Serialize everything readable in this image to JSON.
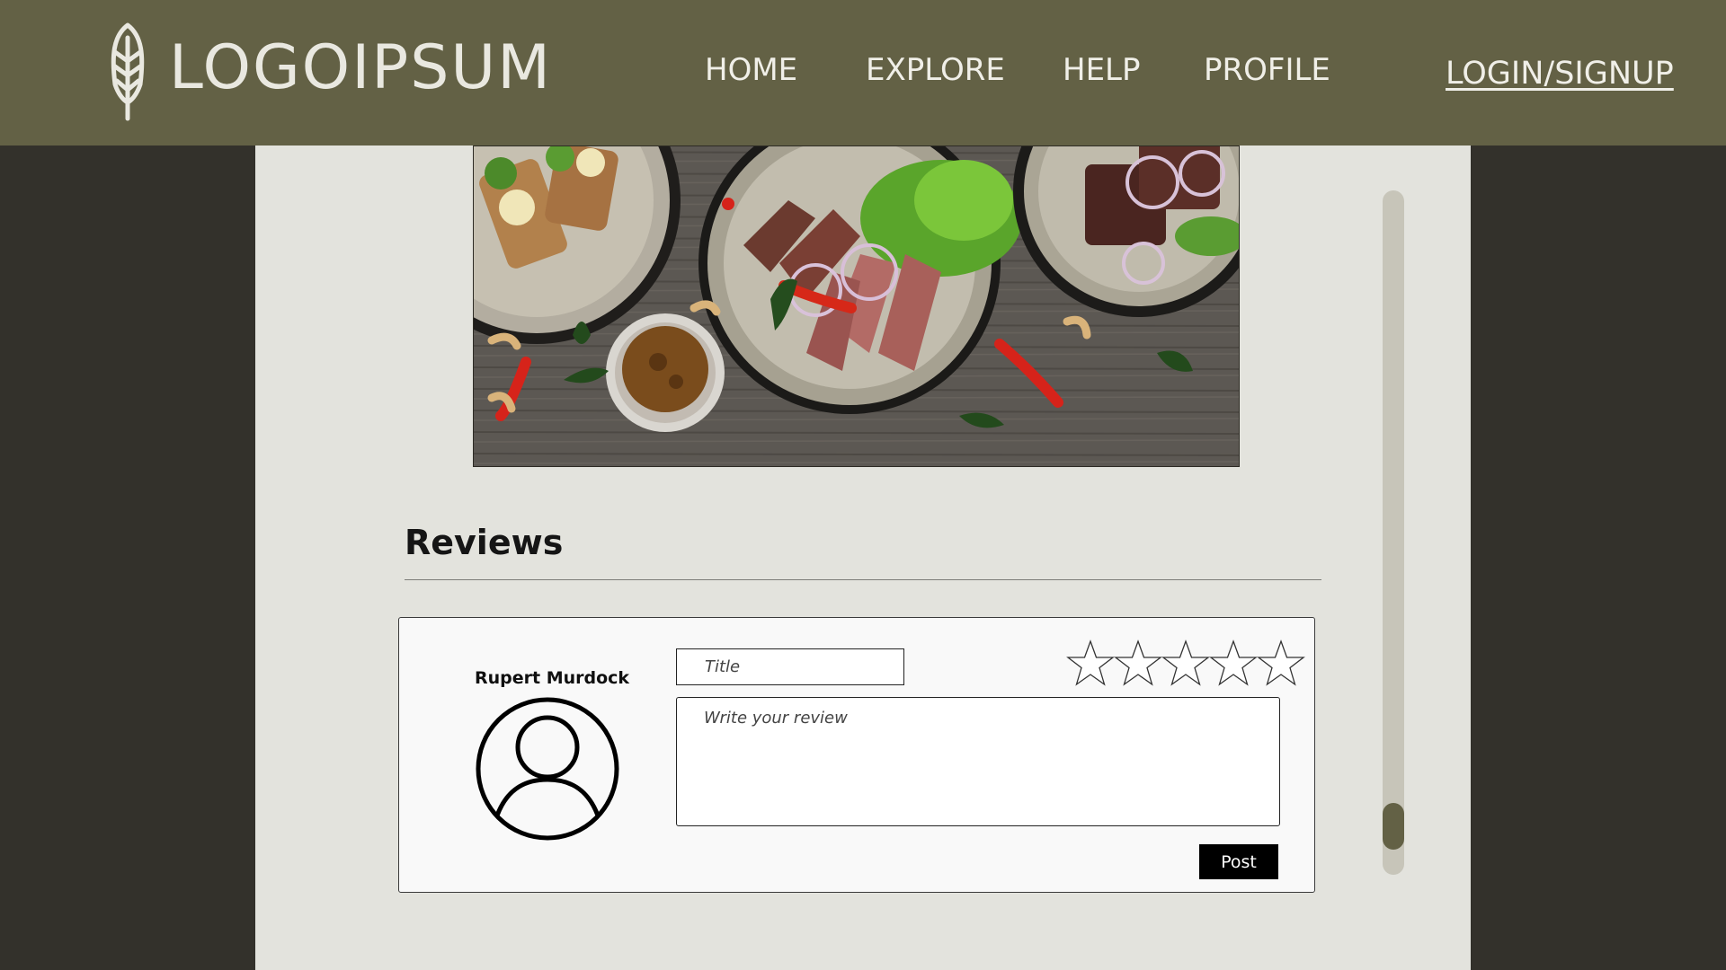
{
  "header": {
    "logo_text": "LOGOIPSUM",
    "nav": [
      "HOME",
      "EXPLORE",
      "HELP",
      "PROFILE"
    ],
    "login_label": "LOGIN/SIGNUP"
  },
  "hero_image": {
    "icon": "food-photo"
  },
  "reviews": {
    "heading": "Reviews",
    "form": {
      "user_name": "Rupert Murdock",
      "title_placeholder": "Title",
      "review_placeholder": "Write your review",
      "rating": 0,
      "rating_max": 5,
      "post_label": "Post"
    }
  },
  "scrollbar": {
    "position_fraction": 0.95
  },
  "colors": {
    "header": "#636145",
    "page_bg": "#33312b",
    "content_bg": "#e3e3dd",
    "scroll_track": "#c7c5b9",
    "scroll_thumb": "#636145"
  }
}
